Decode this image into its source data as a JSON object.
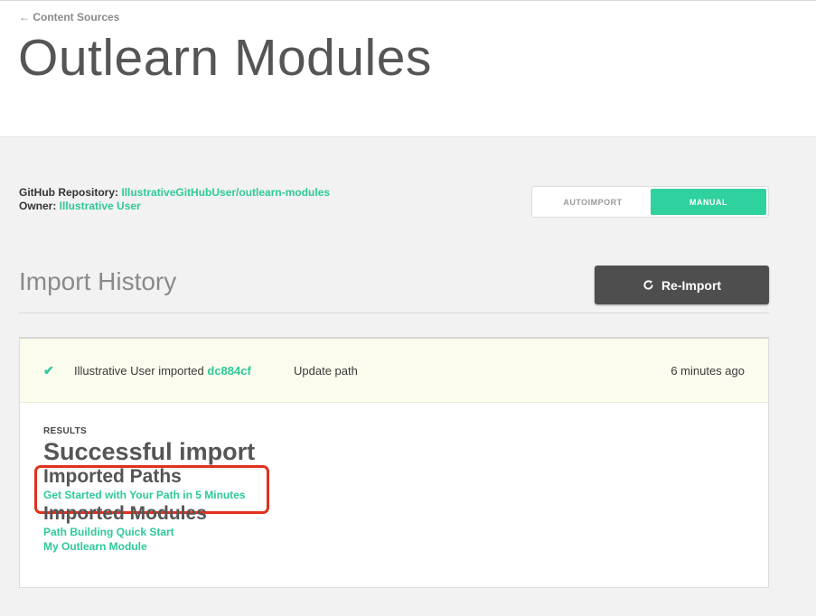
{
  "header": {
    "back_link": "← Content Sources",
    "title": "Outlearn Modules"
  },
  "repo": {
    "repo_label": "GitHub Repository: ",
    "repo_value": "IllustrativeGitHubUser/outlearn-modules",
    "owner_label": "Owner: ",
    "owner_value": "Illustrative User"
  },
  "toggle": {
    "autoimport": "AUTOIMPORT",
    "manual": "MANUAL",
    "selected": "MANUAL"
  },
  "history": {
    "title": "Import History",
    "reimport_label": "Re-Import",
    "entry": {
      "who": "Illustrative User imported ",
      "commit": "dc884cf",
      "message": "Update path",
      "time": "6 minutes ago"
    },
    "results": {
      "label": "RESULTS",
      "status": "Successful import",
      "paths_heading": "Imported Paths",
      "paths": [
        "Get Started with Your Path in 5 Minutes"
      ],
      "modules_heading": "Imported Modules",
      "modules": [
        "Path Building Quick Start",
        "My Outlearn Module"
      ]
    }
  },
  "colors": {
    "accent": "#2ec99a",
    "button_dark": "#4e4e4e",
    "highlight": "#e0301e"
  }
}
